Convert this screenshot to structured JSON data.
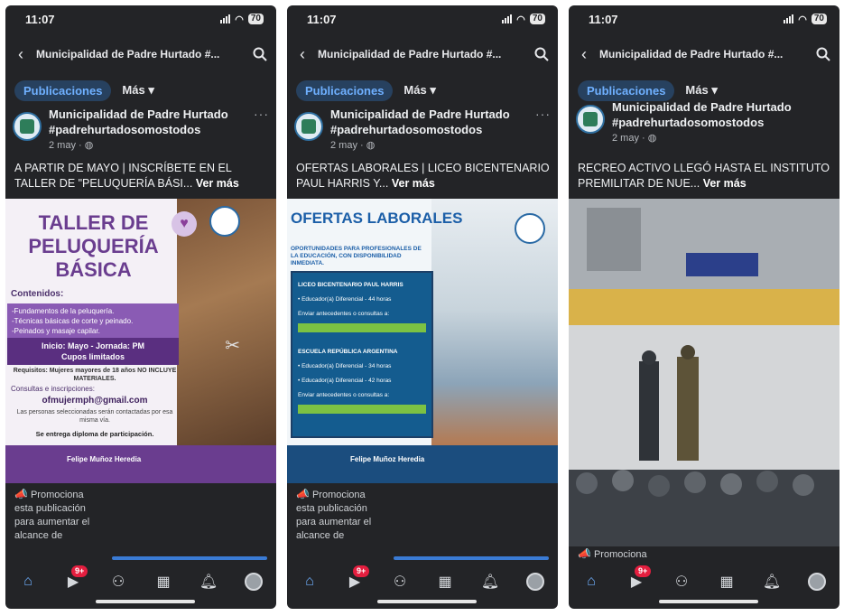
{
  "status": {
    "time": "11:07",
    "battery": "70"
  },
  "header": {
    "title": "Municipalidad de Padre Hurtado #..."
  },
  "tabs": {
    "active": "Publicaciones",
    "more": "Más"
  },
  "page": {
    "name_line1": "Municipalidad de Padre Hurtado",
    "name_line2": "#padrehurtadosomostodos",
    "date": "2 may"
  },
  "see_more": "Ver más",
  "promote": {
    "label": "Promociona esta publicación para aumentar el alcance de",
    "label_short": "Promociona"
  },
  "nav": {
    "badge": "9+",
    "icons": [
      "home-icon",
      "video-icon",
      "friends-icon",
      "marketplace-icon",
      "bell-icon",
      "profile-icon"
    ]
  },
  "posts": [
    {
      "caption": "A PARTIR DE MAYO | INSCRÍBETE EN EL TALLER DE \"PELUQUERÍA BÁSI...",
      "flyer": {
        "title": "TALLER DE PELUQUERÍA BÁSICA",
        "contenidos_label": "Contenidos:",
        "contenidos": [
          "-Fundamentos de la peluquería.",
          "-Técnicas básicas de corte y peinado.",
          "-Peinados y masaje capilar."
        ],
        "inicio": "Inicio: Mayo - Jornada: PM",
        "cupos": "Cupos limitados",
        "requisitos": "Requisitos: Mujeres mayores de 18 años NO INCLUYE MATERIALES.",
        "consultas": "Consultas e inscripciones:",
        "email": "ofmujermph@gmail.com",
        "seleccion": "Las personas seleccionadas serán contactadas por esa misma vía.",
        "diploma": "Se entrega diploma de participación.",
        "mayor": "Felipe Muñoz Heredia"
      }
    },
    {
      "caption": "OFERTAS LABORALES | LICEO BICENTENARIO PAUL HARRIS Y...",
      "flyer": {
        "title": "OFERTAS LABORALES",
        "subtitle": "OPORTUNIDADES PARA PROFESIONALES DE LA EDUCACIÓN, CON DISPONIBILIDAD INMEDIATA.",
        "school1": "LICEO BICENTENARIO PAUL HARRIS",
        "school1_line": "• Educador(a) Diferencial - 44 horas",
        "send": "Enviar antecedentes o consultas a:",
        "school2": "ESCUELA REPÚBLICA ARGENTINA",
        "school2_line1": "• Educador(a) Diferencial - 34 horas",
        "school2_line2": "• Educador(a) Diferencial - 42 horas",
        "mayor": "Felipe Muñoz Heredia"
      }
    },
    {
      "caption": "RECREO ACTIVO LLEGÓ HASTA EL INSTITUTO PREMILITAR DE NUE..."
    }
  ],
  "colors": {
    "background": "#232427",
    "accent_blue": "#6fb0ff",
    "tab_bg": "#27415f",
    "badge_red": "#e41e3f",
    "flyer_purple": "#6a3d8f",
    "flyer_blue": "#1c5fa8"
  }
}
